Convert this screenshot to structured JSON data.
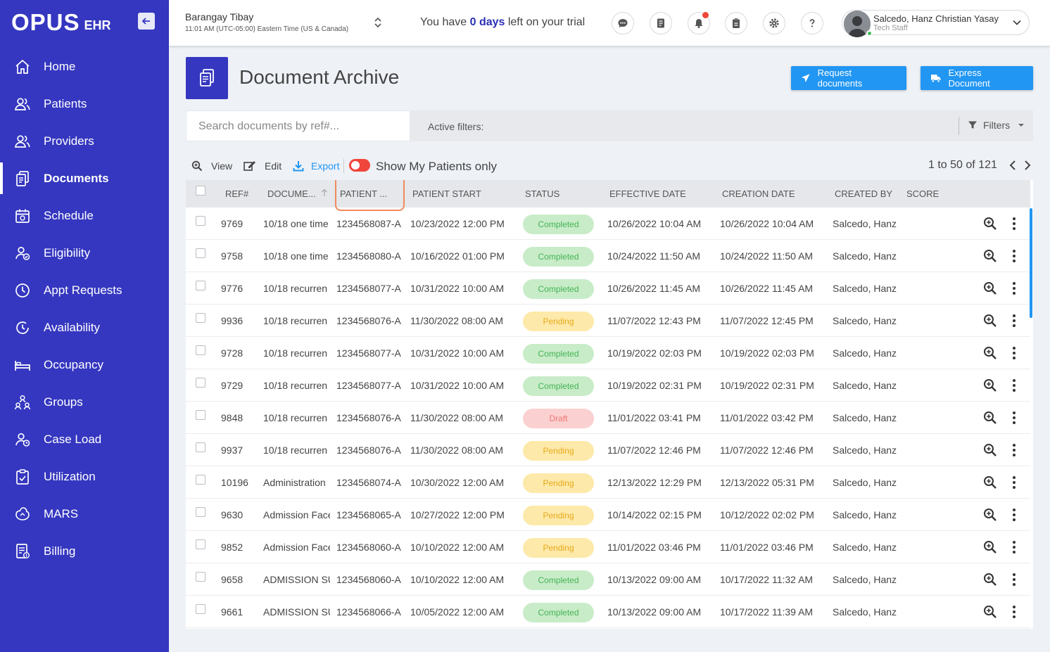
{
  "app": {
    "logo_main": "OPUS",
    "logo_sub": "EHR"
  },
  "sidebar": {
    "items": [
      {
        "label": "Home",
        "icon": "home-icon"
      },
      {
        "label": "Patients",
        "icon": "users-icon"
      },
      {
        "label": "Providers",
        "icon": "users-icon"
      },
      {
        "label": "Documents",
        "icon": "documents-icon",
        "active": true
      },
      {
        "label": "Schedule",
        "icon": "calendar-icon"
      },
      {
        "label": "Eligibility",
        "icon": "user-check-icon"
      },
      {
        "label": "Appt Requests",
        "icon": "clock-icon"
      },
      {
        "label": "Availability",
        "icon": "availability-icon"
      },
      {
        "label": "Occupancy",
        "icon": "bed-icon"
      },
      {
        "label": "Groups",
        "icon": "groups-icon"
      },
      {
        "label": "Case Load",
        "icon": "caseload-icon"
      },
      {
        "label": "Utilization",
        "icon": "clipboard-icon"
      },
      {
        "label": "MARS",
        "icon": "mars-icon"
      },
      {
        "label": "Billing",
        "icon": "billing-icon"
      }
    ]
  },
  "header": {
    "location_name": "Barangay Tibay",
    "location_tz": "11:01 AM (UTC-05:00) Eastern Time (US & Canada)",
    "trial_prefix": "You have ",
    "trial_days": "0 days",
    "trial_suffix": " left on your trial",
    "user_name": "Salcedo, Hanz Christian Yasay",
    "user_role": "Tech Staff"
  },
  "page": {
    "title": "Document Archive",
    "request_button": "Request documents",
    "express_button": "Express Document",
    "search_placeholder": "Search documents by ref#...",
    "active_filters_label": "Active filters:",
    "filters_button": "Filters"
  },
  "toolbar": {
    "view_label": "View",
    "edit_label": "Edit",
    "export_label": "Export",
    "show_mine_label": "Show My Patients only",
    "pager_text": "1 to 50 of 121"
  },
  "table": {
    "columns": [
      "REF#",
      "DOCUME...",
      "PATIENT ...",
      "PATIENT START",
      "STATUS",
      "EFFECTIVE DATE",
      "CREATION DATE",
      "CREATED BY",
      "SCORE"
    ],
    "rows": [
      {
        "ref": "9769",
        "doc": "10/18 one time",
        "patient": "1234568087-A",
        "start": "10/23/2022 12:00 PM",
        "status": "Completed",
        "effective": "10/26/2022 10:04 AM",
        "created": "10/26/2022 10:04 AM",
        "by": "Salcedo, Hanz C"
      },
      {
        "ref": "9758",
        "doc": "10/18 one time",
        "patient": "1234568080-A",
        "start": "10/16/2022 01:00 PM",
        "status": "Completed",
        "effective": "10/24/2022 11:50 AM",
        "created": "10/24/2022 11:50 AM",
        "by": "Salcedo, Hanz C"
      },
      {
        "ref": "9776",
        "doc": "10/18 recurren",
        "patient": "1234568077-A",
        "start": "10/31/2022 10:00 AM",
        "status": "Completed",
        "effective": "10/26/2022 11:45 AM",
        "created": "10/26/2022 11:45 AM",
        "by": "Salcedo, Hanz C"
      },
      {
        "ref": "9936",
        "doc": "10/18 recurren",
        "patient": "1234568076-A",
        "start": "11/30/2022 08:00 AM",
        "status": "Pending",
        "effective": "11/07/2022 12:43 PM",
        "created": "11/07/2022 12:45 PM",
        "by": "Salcedo, Hanz C"
      },
      {
        "ref": "9728",
        "doc": "10/18 recurren",
        "patient": "1234568077-A",
        "start": "10/31/2022 10:00 AM",
        "status": "Completed",
        "effective": "10/19/2022 02:03 PM",
        "created": "10/19/2022 02:03 PM",
        "by": "Salcedo, Hanz C"
      },
      {
        "ref": "9729",
        "doc": "10/18 recurren",
        "patient": "1234568077-A",
        "start": "10/31/2022 10:00 AM",
        "status": "Completed",
        "effective": "10/19/2022 02:31 PM",
        "created": "10/19/2022 02:31 PM",
        "by": "Salcedo, Hanz C"
      },
      {
        "ref": "9848",
        "doc": "10/18 recurren",
        "patient": "1234568076-A",
        "start": "11/30/2022 08:00 AM",
        "status": "Draft",
        "effective": "11/01/2022 03:41 PM",
        "created": "11/01/2022 03:42 PM",
        "by": "Salcedo, Hanz C"
      },
      {
        "ref": "9937",
        "doc": "10/18 recurren",
        "patient": "1234568076-A",
        "start": "11/30/2022 08:00 AM",
        "status": "Pending",
        "effective": "11/07/2022 12:46 PM",
        "created": "11/07/2022 12:46 PM",
        "by": "Salcedo, Hanz C"
      },
      {
        "ref": "10196",
        "doc": "Administration",
        "patient": "1234568074-A",
        "start": "10/30/2022 12:00 AM",
        "status": "Pending",
        "effective": "12/13/2022 12:29 PM",
        "created": "12/13/2022 05:31 PM",
        "by": "Salcedo, Hanz C"
      },
      {
        "ref": "9630",
        "doc": "Admission Face",
        "patient": "1234568065-A",
        "start": "10/27/2022 12:00 PM",
        "status": "Pending",
        "effective": "10/14/2022 02:15 PM",
        "created": "10/12/2022 02:02 PM",
        "by": "Salcedo, Hanz C"
      },
      {
        "ref": "9852",
        "doc": "Admission Face",
        "patient": "1234568060-A",
        "start": "10/10/2022 12:00 AM",
        "status": "Pending",
        "effective": "11/01/2022 03:46 PM",
        "created": "11/01/2022 03:46 PM",
        "by": "Salcedo, Hanz C"
      },
      {
        "ref": "9658",
        "doc": "ADMISSION SU",
        "patient": "1234568060-A",
        "start": "10/10/2022 12:00 AM",
        "status": "Completed",
        "effective": "10/13/2022 09:00 AM",
        "created": "10/17/2022 11:32 AM",
        "by": "Salcedo, Hanz C"
      },
      {
        "ref": "9661",
        "doc": "ADMISSION SU",
        "patient": "1234568066-A",
        "start": "10/05/2022 12:00 AM",
        "status": "Completed",
        "effective": "10/13/2022 09:00 AM",
        "created": "10/17/2022 11:39 AM",
        "by": "Salcedo, Hanz C"
      }
    ]
  }
}
